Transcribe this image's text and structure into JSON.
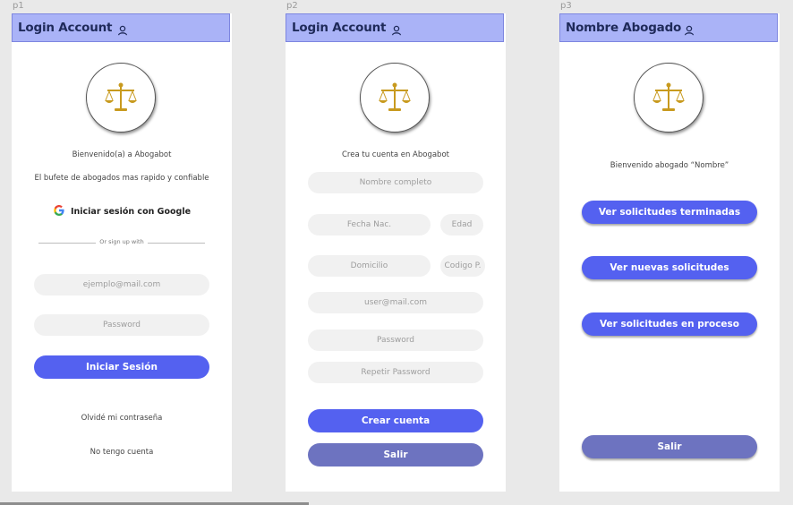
{
  "screens": [
    {
      "label": "p1",
      "header_title": "Login Account",
      "welcome": "Bienvenido(a) a Abogabot",
      "tagline": "El bufete de abogados mas rapido y confiable",
      "google_label": "Iniciar sesión con Google",
      "divider_text": "Or sign up with",
      "email_placeholder": "ejemplo@mail.com",
      "password_placeholder": "Password",
      "login_button": "Iniciar Sesión",
      "forgot_link": "Olvidé mi contraseña",
      "no_account_link": "No tengo cuenta"
    },
    {
      "label": "p2",
      "header_title": "Login Account",
      "intro": "Crea tu cuenta en Abogabot",
      "name_placeholder": "Nombre completo",
      "birth_placeholder": "Fecha Nac.",
      "age_placeholder": "Edad",
      "address_placeholder": "Domicilio",
      "zip_placeholder": "Codigo P.",
      "email_placeholder": "user@mail.com",
      "password_placeholder": "Password",
      "repeat_password_placeholder": "Repetir Password",
      "create_button": "Crear cuenta",
      "exit_button": "Salir"
    },
    {
      "label": "p3",
      "header_title": "Nombre Abogado",
      "welcome": "Bienvenido abogado “Nombre”",
      "finished_button": "Ver solicitudes terminadas",
      "new_button": "Ver nuevas solicitudes",
      "in_progress_button": "Ver solicitudes en proceso",
      "exit_button": "Salir"
    }
  ],
  "icons": {
    "header": "user-icon",
    "logo": "scales-of-justice-icon",
    "google": "google-icon"
  },
  "colors": {
    "header_bg": "#aab3f7",
    "primary_button": "#5461f0",
    "muted_button": "#6d73c0",
    "input_bg": "#f1f1f1",
    "logo_gold": "#c89a1e"
  }
}
